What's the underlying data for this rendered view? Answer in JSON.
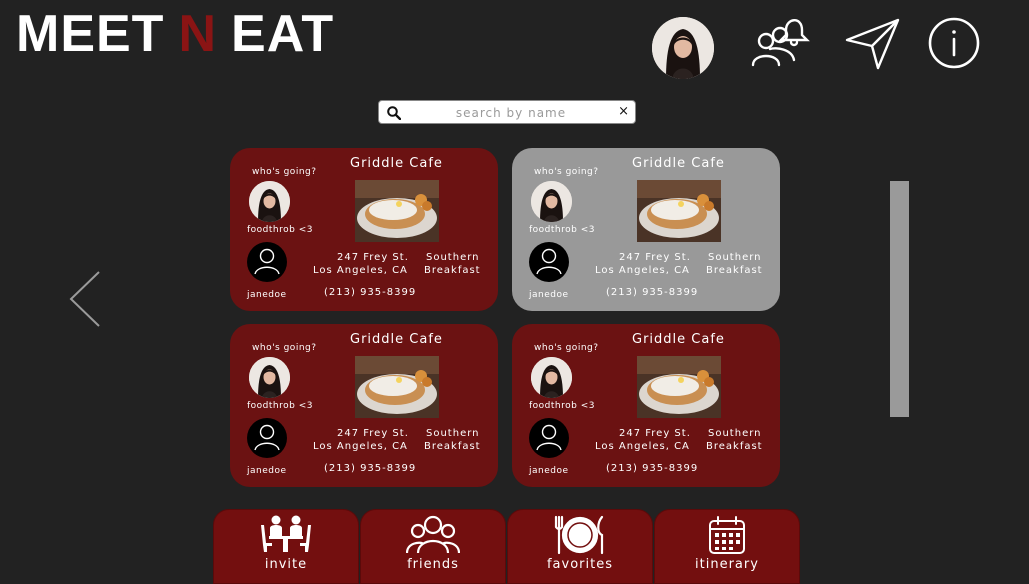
{
  "app": {
    "logo_part_a": "MEET",
    "logo_part_b": "N",
    "logo_part_c": "EAT"
  },
  "search": {
    "placeholder": "search by name",
    "clear_label": "×"
  },
  "cards": [
    {
      "question": "who's going?",
      "restaurant": "Griddle Cafe",
      "friend1": "foodthrob <3",
      "friend2": "janedoe",
      "street": "247 Frey St.",
      "city": "Los Angeles, CA",
      "cuisine_line1": "Southern",
      "cuisine_line2": "Breakfast",
      "phone": "(213) 935-8399"
    },
    {
      "question": "who's going?",
      "restaurant": "Griddle Cafe",
      "friend1": "foodthrob <3",
      "friend2": "janedoe",
      "street": "247 Frey St.",
      "city": "Los Angeles, CA",
      "cuisine_line1": "Southern",
      "cuisine_line2": "Breakfast",
      "phone": "(213) 935-8399"
    },
    {
      "question": "who's going?",
      "restaurant": "Griddle Cafe",
      "friend1": "foodthrob <3",
      "friend2": "janedoe",
      "street": "247 Frey St.",
      "city": "Los Angeles, CA",
      "cuisine_line1": "Southern",
      "cuisine_line2": "Breakfast",
      "phone": "(213) 935-8399"
    },
    {
      "question": "who's going?",
      "restaurant": "Griddle Cafe",
      "friend1": "foodthrob <3",
      "friend2": "janedoe",
      "street": "247 Frey St.",
      "city": "Los Angeles, CA",
      "cuisine_line1": "Southern",
      "cuisine_line2": "Breakfast",
      "phone": "(213) 935-8399"
    }
  ],
  "tabs": [
    {
      "label": "invite",
      "icon": "people-at-table-icon"
    },
    {
      "label": "friends",
      "icon": "friends-group-icon"
    },
    {
      "label": "favorites",
      "icon": "plate-fork-knife-icon"
    },
    {
      "label": "itinerary",
      "icon": "calendar-icon"
    }
  ],
  "header_icons": [
    "profile-avatar",
    "friends-notification-icon",
    "send-icon",
    "info-icon"
  ],
  "colors": {
    "background": "#222222",
    "card": "#6b1212",
    "card_selected": "#999999",
    "tab": "#730f0f",
    "logo_accent": "#8a1414"
  }
}
